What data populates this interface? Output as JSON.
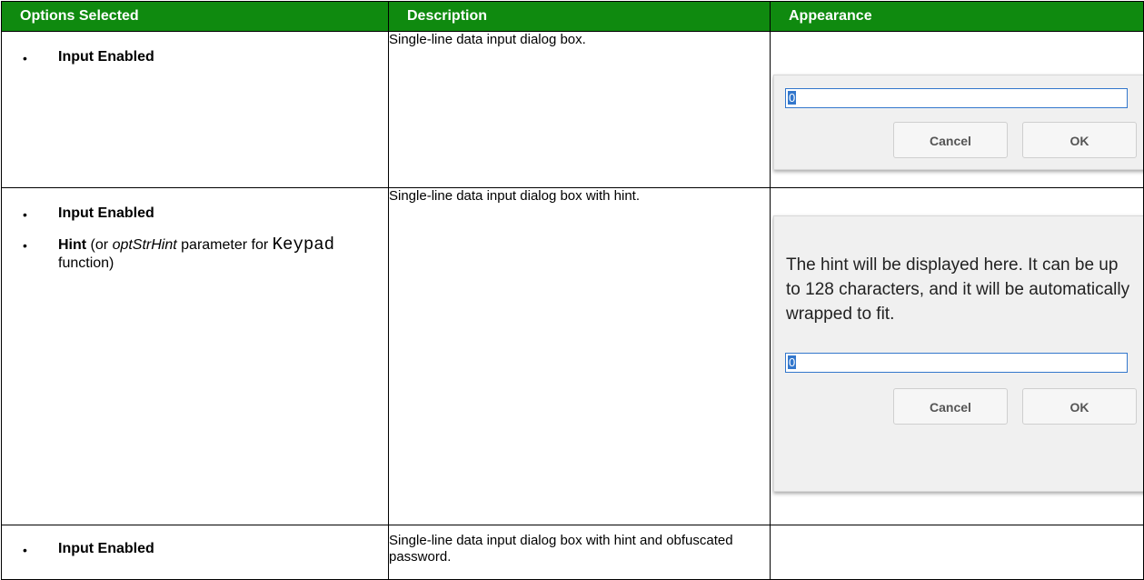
{
  "headers": {
    "options": "Options Selected",
    "description": "Description",
    "appearance": "Appearance"
  },
  "rows": [
    {
      "bullets": [
        {
          "bold": "Input Enabled"
        }
      ],
      "description": "Single-line data input dialog box.",
      "dialog": {
        "input_value": "0",
        "cancel_label": "Cancel",
        "ok_label": "OK"
      }
    },
    {
      "bullets": [
        {
          "bold": "Input Enabled"
        },
        {
          "bold": "Hint",
          "pre": " (or ",
          "italic": "optStrHint",
          "mid": " parameter for ",
          "mono": "Keypad",
          "post": " function)"
        }
      ],
      "description": "Single-line data input dialog box with hint.",
      "dialog": {
        "hint": "The hint will be displayed here. It can be up to 128 characters, and it will be automatically wrapped to fit.",
        "input_value": "0",
        "cancel_label": "Cancel",
        "ok_label": "OK"
      }
    },
    {
      "bullets": [
        {
          "bold": "Input Enabled"
        }
      ],
      "description": "Single-line data input dialog box with hint and obfuscated password."
    }
  ],
  "bullet_glyph": "•"
}
